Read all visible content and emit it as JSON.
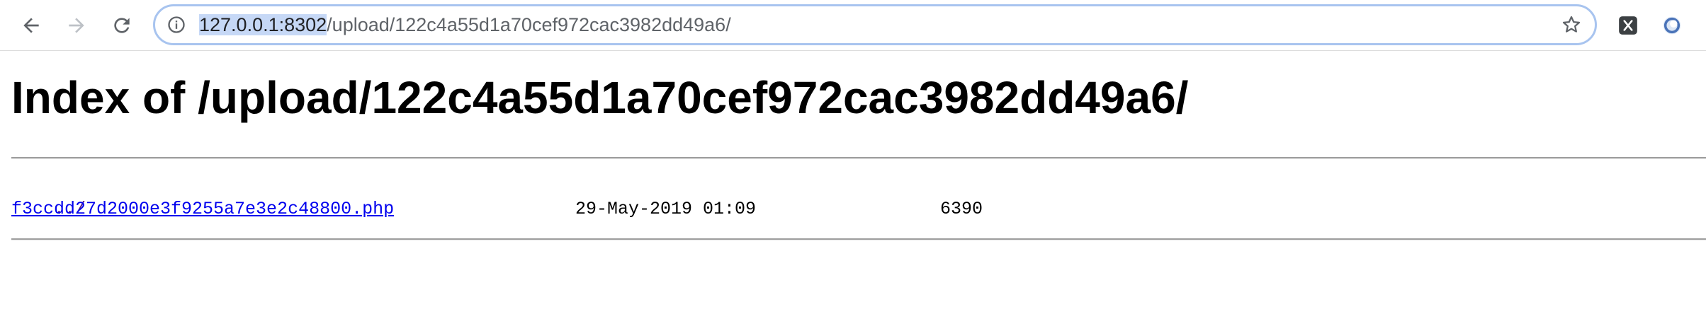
{
  "browser": {
    "url_host": "127.0.0.1:8302",
    "url_path": "/upload/122c4a55d1a70cef972cac3982dd49a6/",
    "icons": {
      "back": "arrow-left-icon",
      "forward": "arrow-right-icon",
      "reload": "reload-icon",
      "info": "info-icon",
      "bookmark": "star-icon",
      "extension1": "extension-x-icon",
      "extension2": "extension-ring-icon"
    }
  },
  "page": {
    "title": "Index of /upload/122c4a55d1a70cef972cac3982dd49a6/",
    "parent_link": "../",
    "files": [
      {
        "name": "f3ccdd27d2000e3f9255a7e3e2c48800.php",
        "date": "29-May-2019 01:09",
        "size": "6390"
      }
    ]
  }
}
